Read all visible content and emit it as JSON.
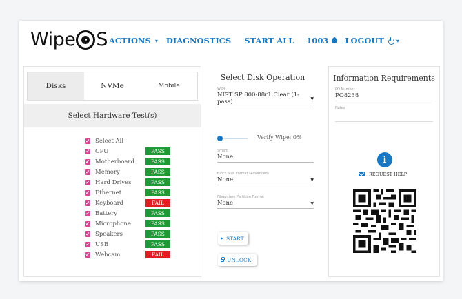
{
  "header": {
    "logo_text_left": "Wipe",
    "logo_text_right": "S",
    "nav": {
      "actions": "ACTIONS",
      "diagnostics": "DIAGNOSTICS",
      "start_all": "START ALL",
      "user": "1003",
      "logout": "LOGOUT"
    }
  },
  "left_panel": {
    "tabs": [
      {
        "label": "Disks",
        "active": true
      },
      {
        "label": "NVMe",
        "active": false
      },
      {
        "label": "Mobile",
        "active": false
      }
    ],
    "section_title": "Select Hardware Test(s)",
    "tests": [
      {
        "label": "Select All",
        "status": ""
      },
      {
        "label": "CPU",
        "status": "PASS"
      },
      {
        "label": "Motherboard",
        "status": "PASS"
      },
      {
        "label": "Memory",
        "status": "PASS"
      },
      {
        "label": "Hard Drives",
        "status": "PASS"
      },
      {
        "label": "Ethernet",
        "status": "PASS"
      },
      {
        "label": "Keyboard",
        "status": "FAIL"
      },
      {
        "label": "Battery",
        "status": "PASS"
      },
      {
        "label": "Microphone",
        "status": "PASS"
      },
      {
        "label": "Speakers",
        "status": "PASS"
      },
      {
        "label": "USB",
        "status": "PASS"
      },
      {
        "label": "Webcam",
        "status": "FAIL"
      }
    ]
  },
  "middle_panel": {
    "title": "Select Disk Operation",
    "wipe": {
      "label": "Wipe",
      "value": "NIST SP 800-88r1 Clear (1-pass)"
    },
    "verify": {
      "label": "Verify Wipe: 0%",
      "percent": 0
    },
    "smart": {
      "label": "Smart",
      "value": "None"
    },
    "block_size": {
      "label": "Block Size Format (Advanced)",
      "value": "None"
    },
    "filesystem": {
      "label": "Filesystem Partition Format",
      "value": "None"
    },
    "start_button": "START",
    "unlock_button": "UNLOCK"
  },
  "right_panel": {
    "title": "Information Requirements",
    "po": {
      "label": "PO Number",
      "value": "PO8238"
    },
    "notes": {
      "label": "Notes",
      "value": ""
    },
    "request_help": "REQUEST HELP"
  },
  "colors": {
    "accent": "#1a78c2",
    "pass": "#1e9b36",
    "fail": "#e01e24",
    "checkbox": "#d0488f"
  }
}
